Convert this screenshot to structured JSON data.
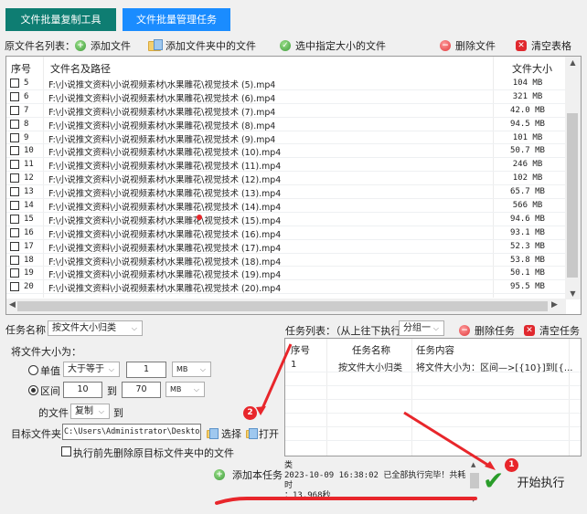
{
  "tabs": [
    {
      "label": "文件批量复制工具",
      "color": "#0e7d72"
    },
    {
      "label": "文件批量管理任务",
      "color": "#1a8cff"
    }
  ],
  "toolbar": {
    "list_label": "原文件名列表：",
    "add_file": "添加文件",
    "add_folder": "添加文件夹中的文件",
    "select_size": "选中指定大小的文件",
    "delete_file": "删除文件",
    "clear_table": "清空表格"
  },
  "file_table": {
    "headers": {
      "no": "序号",
      "path": "文件名及路径",
      "size": "文件大小"
    },
    "rows": [
      {
        "no": "5",
        "path": "F:\\小说推文资料\\小说视频素材\\水果雕花\\视觉技术 (5).mp4",
        "size": "104 MB"
      },
      {
        "no": "6",
        "path": "F:\\小说推文资料\\小说视频素材\\水果雕花\\视觉技术 (6).mp4",
        "size": "321 MB"
      },
      {
        "no": "7",
        "path": "F:\\小说推文资料\\小说视频素材\\水果雕花\\视觉技术 (7).mp4",
        "size": "42.0 MB"
      },
      {
        "no": "8",
        "path": "F:\\小说推文资料\\小说视频素材\\水果雕花\\视觉技术 (8).mp4",
        "size": "94.5 MB"
      },
      {
        "no": "9",
        "path": "F:\\小说推文资料\\小说视频素材\\水果雕花\\视觉技术 (9).mp4",
        "size": "101 MB"
      },
      {
        "no": "10",
        "path": "F:\\小说推文资料\\小说视频素材\\水果雕花\\视觉技术 (10).mp4",
        "size": "50.7 MB"
      },
      {
        "no": "11",
        "path": "F:\\小说推文资料\\小说视频素材\\水果雕花\\视觉技术 (11).mp4",
        "size": "246 MB"
      },
      {
        "no": "12",
        "path": "F:\\小说推文资料\\小说视频素材\\水果雕花\\视觉技术 (12).mp4",
        "size": "102 MB"
      },
      {
        "no": "13",
        "path": "F:\\小说推文资料\\小说视频素材\\水果雕花\\视觉技术 (13).mp4",
        "size": "65.7 MB"
      },
      {
        "no": "14",
        "path": "F:\\小说推文资料\\小说视频素材\\水果雕花\\视觉技术 (14).mp4",
        "size": "566 MB"
      },
      {
        "no": "15",
        "path": "F:\\小说推文资料\\小说视频素材\\水果雕花\\视觉技术 (15).mp4",
        "size": "94.6 MB"
      },
      {
        "no": "16",
        "path": "F:\\小说推文资料\\小说视频素材\\水果雕花\\视觉技术 (16).mp4",
        "size": "93.1 MB"
      },
      {
        "no": "17",
        "path": "F:\\小说推文资料\\小说视频素材\\水果雕花\\视觉技术 (17).mp4",
        "size": "52.3 MB"
      },
      {
        "no": "18",
        "path": "F:\\小说推文资料\\小说视频素材\\水果雕花\\视觉技术 (18).mp4",
        "size": "53.8 MB"
      },
      {
        "no": "19",
        "path": "F:\\小说推文资料\\小说视频素材\\水果雕花\\视觉技术 (19).mp4",
        "size": "50.1 MB"
      },
      {
        "no": "20",
        "path": "F:\\小说推文资料\\小说视频素材\\水果雕花\\视觉技术 (20).mp4",
        "size": "95.5 MB"
      }
    ]
  },
  "task_form": {
    "task_name_label": "任务名称：",
    "task_name_value": "按文件大小归类",
    "size_label": "将文件大小为：",
    "single_label": "单值",
    "single_op": "大于等于",
    "single_value": "1",
    "single_unit": "MB",
    "range_label": "区间",
    "range_from": "10",
    "range_to_label": "到",
    "range_to": "70",
    "range_unit": "MB",
    "file_label": "的文件",
    "action": "复制",
    "to_label": "到",
    "target_label": "目标文件夹：",
    "target_value": "C:\\Users\\Administrator\\Desktop\\新",
    "select_btn": "选择",
    "open_btn": "打开",
    "delete_before_label": "执行前先删除原目标文件夹中的文件",
    "add_task_btn": "添加本任务"
  },
  "task_list": {
    "label": "任务列表：（从上往下执行）",
    "group": "分组一",
    "delete_task": "删除任务",
    "clear_task": "清空任务",
    "headers": {
      "no": "序号",
      "name": "任务名称",
      "content": "任务内容"
    },
    "rows": [
      {
        "no": "1",
        "name": "按文件大小归类",
        "content": "将文件大小为：区间—>[{10}]到[{..."
      }
    ]
  },
  "log": {
    "line1": "类",
    "line2": "2023-10-09 16:38:02 已全部执行完毕！共耗时",
    "line3": "：13.968秒"
  },
  "start_button": "开始执行",
  "annotations": {
    "badge1": "1",
    "badge2": "2",
    "color": "#e8262b"
  }
}
